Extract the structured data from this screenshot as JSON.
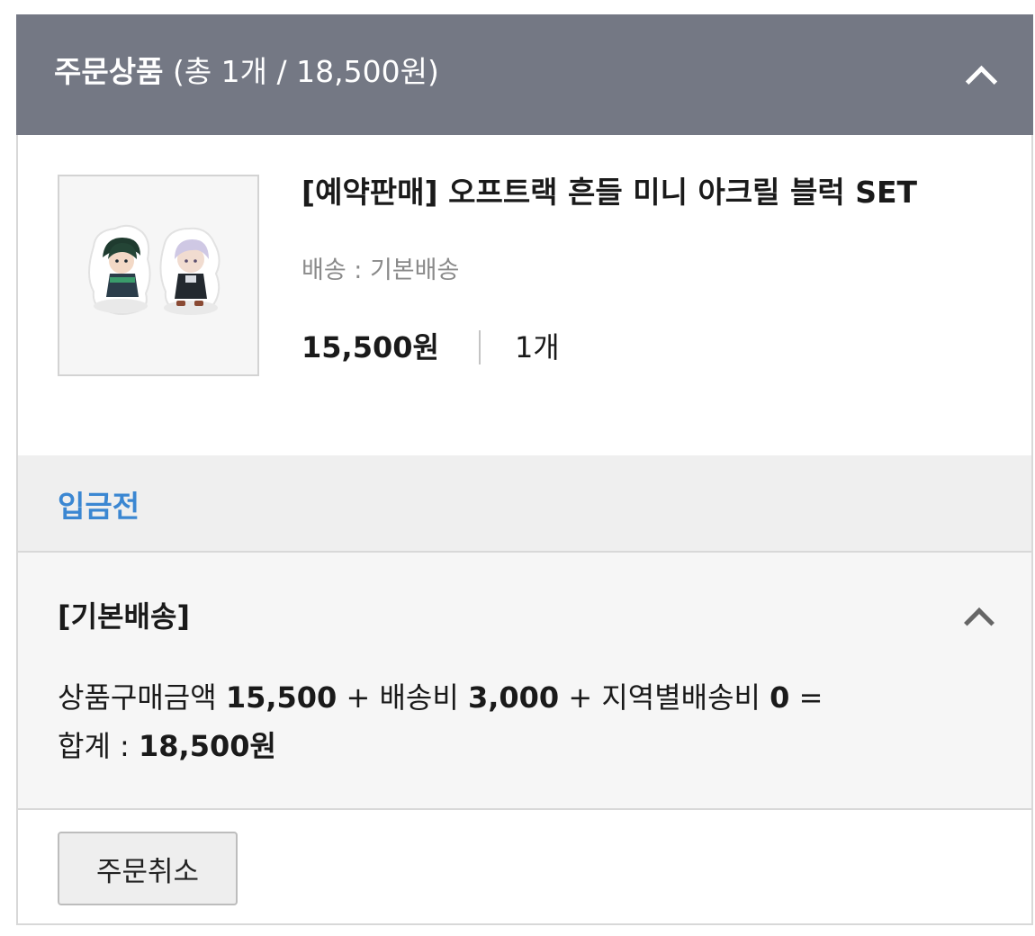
{
  "header": {
    "title": "주문상품",
    "summary": "(총 1개 / 18,500원)"
  },
  "product": {
    "name": "[예약판매] 오프트랙 흔들 미니 아크릴 블럭 SET",
    "shipping_type": "배송 : 기본배송",
    "price": "15,500원",
    "quantity": "1개"
  },
  "status": {
    "label": "입금전"
  },
  "delivery": {
    "title": "[기본배송]",
    "calc": {
      "label_goods": "상품구매금액",
      "goods_amount": "15,500",
      "plus1": "+",
      "label_shipping": "배송비",
      "shipping_amount": "3,000",
      "plus2": "+",
      "label_regional": "지역별배송비",
      "regional_amount": "0",
      "equals": "=",
      "label_total": "합계 :",
      "total_amount": "18,500원"
    }
  },
  "actions": {
    "cancel_label": "주문취소"
  },
  "colors": {
    "header_bg": "#747884",
    "status_blue": "#3b87d2"
  },
  "icons": {
    "header_toggle": "chevron-up-icon",
    "delivery_toggle": "chevron-up-icon"
  }
}
